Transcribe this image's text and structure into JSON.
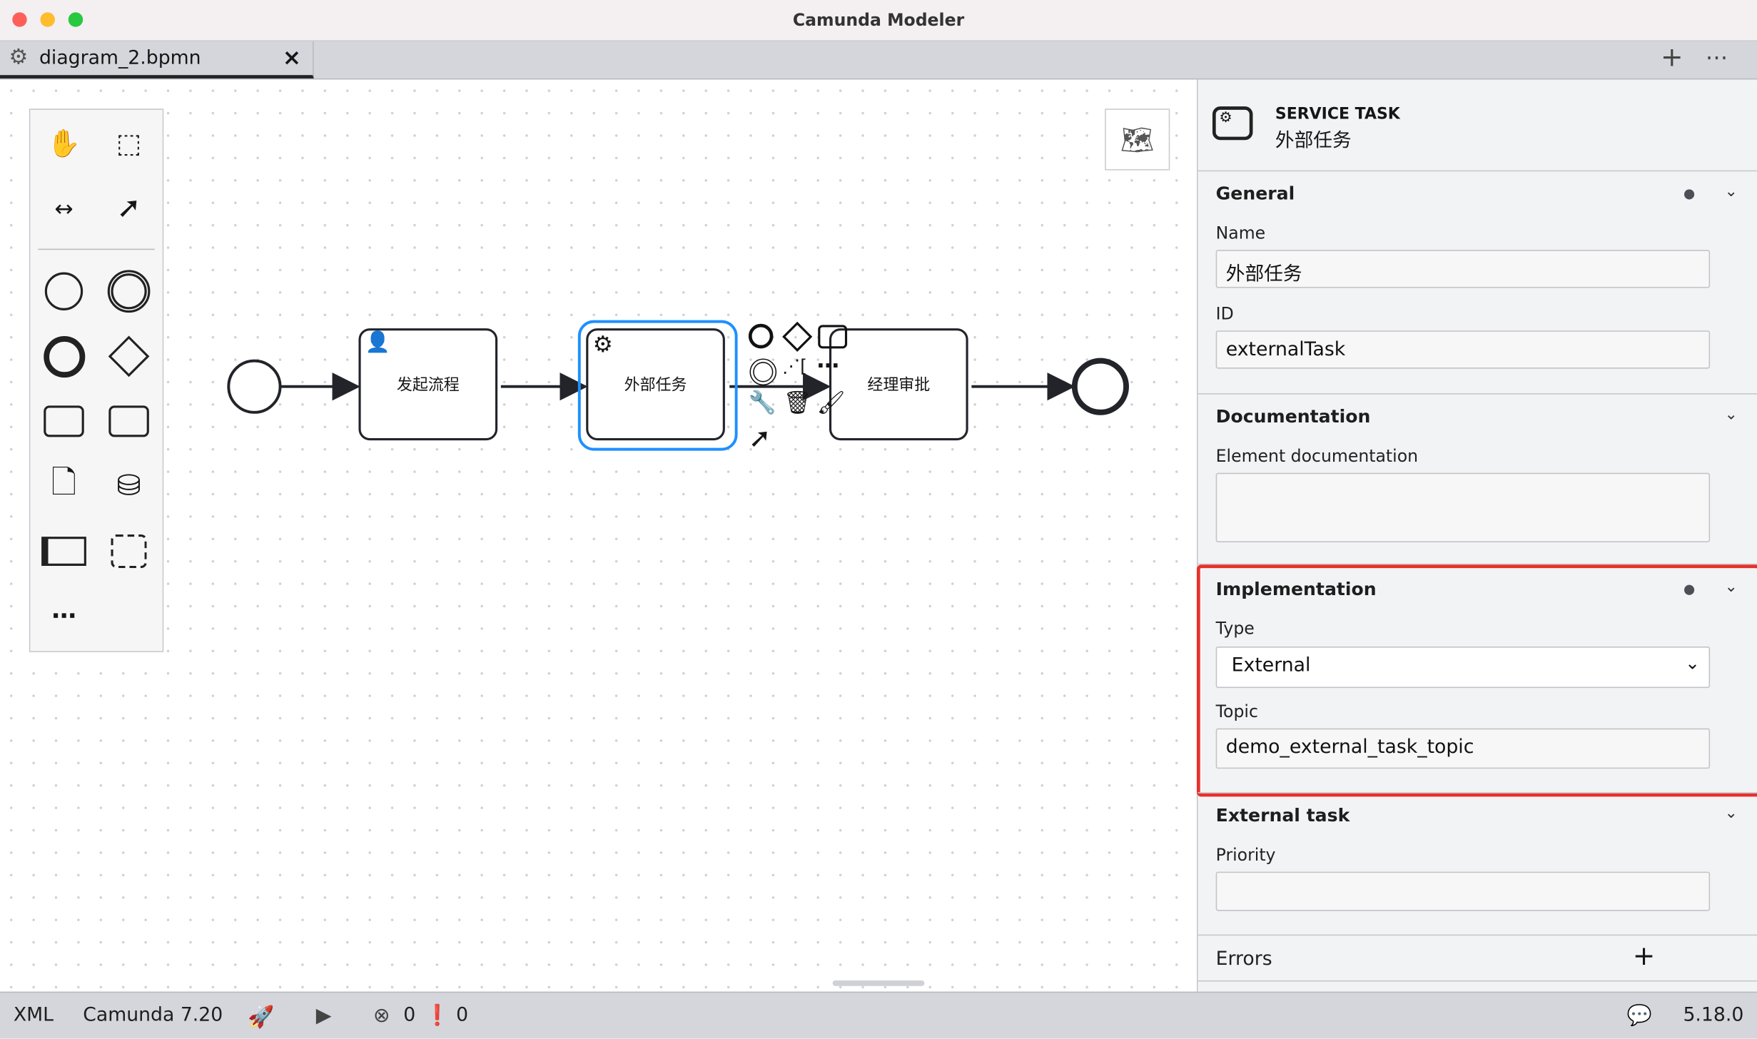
{
  "window": {
    "title": "Camunda Modeler"
  },
  "tabs": [
    {
      "label": "diagram_2.bpmn",
      "close": "×"
    }
  ],
  "tabbar_actions": {
    "add": "+",
    "more": "⋯"
  },
  "diagram": {
    "tasks": [
      {
        "label": "发起流程",
        "type": "user-task"
      },
      {
        "label": "外部任务",
        "type": "service-task",
        "selected": true
      },
      {
        "label": "经理审批",
        "type": "user-task"
      }
    ],
    "selection_color": "#1e90ff"
  },
  "properties": {
    "header": {
      "type": "SERVICE TASK",
      "name": "外部任务"
    },
    "general": {
      "title": "General",
      "name_label": "Name",
      "name_value": "外部任务",
      "id_label": "ID",
      "id_value": "externalTask"
    },
    "documentation": {
      "title": "Documentation",
      "label": "Element documentation",
      "value": ""
    },
    "implementation": {
      "title": "Implementation",
      "type_label": "Type",
      "type_value": "External",
      "topic_label": "Topic",
      "topic_value": "demo_external_task_topic",
      "highlight_color": "#e8302a"
    },
    "external_task": {
      "title": "External task",
      "priority_label": "Priority",
      "priority_value": ""
    },
    "errors": {
      "title": "Errors",
      "add": "+"
    }
  },
  "statusbar": {
    "xml": "XML",
    "engine": "Camunda 7.20",
    "errors": "0",
    "warnings": "0",
    "version": "5.18.0"
  }
}
